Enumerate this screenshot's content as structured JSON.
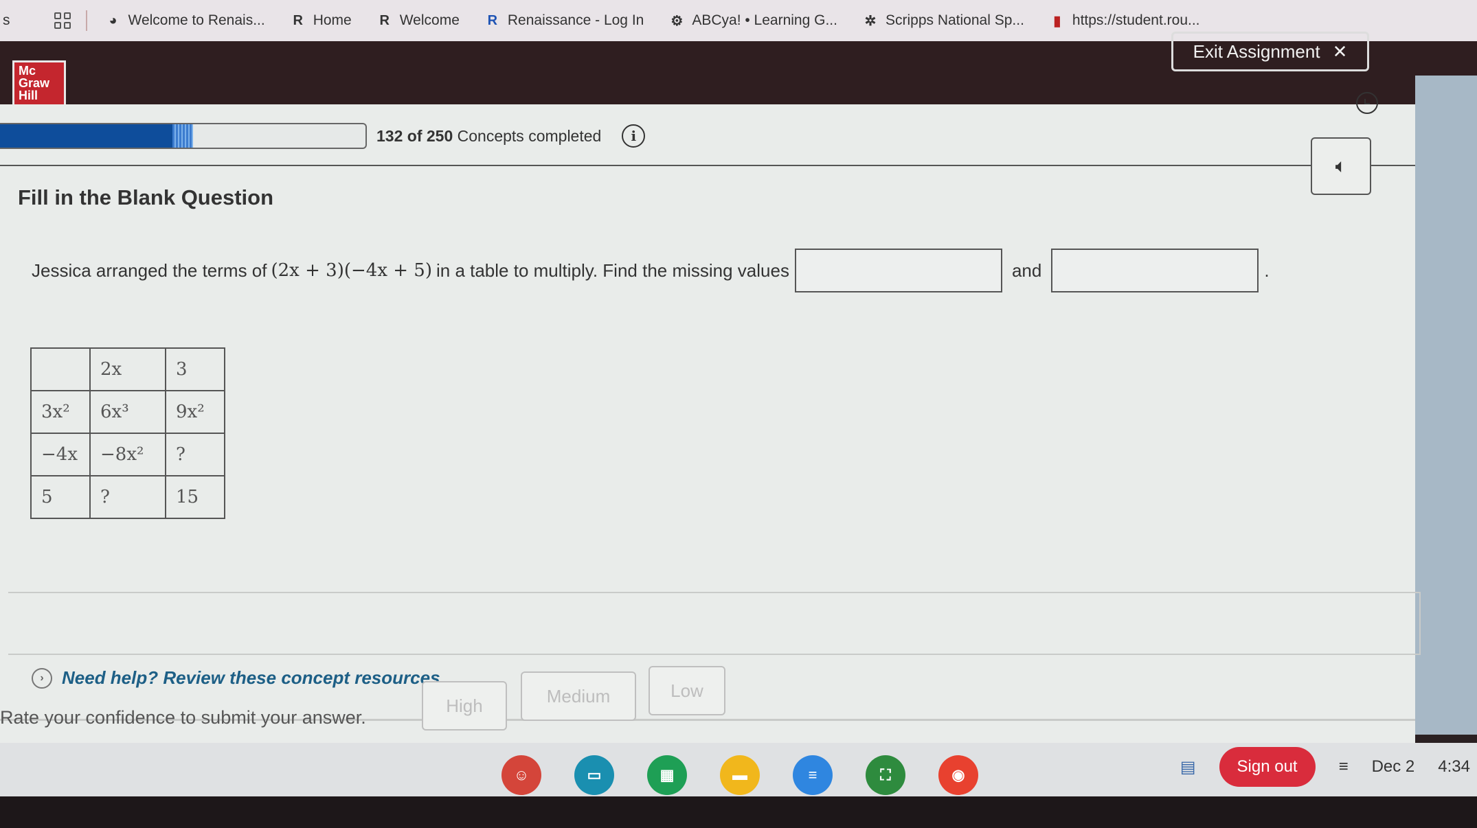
{
  "bookmarks": [
    {
      "icon": "partial-bookmark",
      "label": "s"
    },
    {
      "icon": "globe-icon",
      "label": "Welcome to Renais..."
    },
    {
      "icon": "renaissance-icon",
      "label": "Home"
    },
    {
      "icon": "renaissance-icon",
      "label": "Welcome"
    },
    {
      "icon": "renaissance-r-icon",
      "label": "Renaissance - Log In"
    },
    {
      "icon": "abcya-icon",
      "label": "ABCya! • Learning G..."
    },
    {
      "icon": "scripps-icon",
      "label": "Scripps National Sp..."
    },
    {
      "icon": "student-icon",
      "label": "https://student.rou..."
    }
  ],
  "header": {
    "logo_lines": [
      "Mc",
      "Graw",
      "Hill"
    ],
    "exit_label": "Exit Assignment",
    "exit_icon": "✕"
  },
  "progress": {
    "completed": 132,
    "total": 250,
    "fraction": 0.528,
    "count_text": "132 of 250",
    "suffix": "Concepts completed",
    "info_icon": "i"
  },
  "question": {
    "type_title": "Fill in the Blank Question",
    "prefix": "Jessica arranged the terms of",
    "expression": "(2x + 3)(−4x + 5)",
    "middle": "in a table to multiply. Find the missing values",
    "blank1_value": "",
    "and": "and",
    "blank2_value": "",
    "end": "."
  },
  "table": {
    "rows": [
      [
        "",
        "2x",
        "3"
      ],
      [
        "3x²",
        "6x³",
        "9x²"
      ],
      [
        "−4x",
        "−8x²",
        "?"
      ],
      [
        "5",
        "?",
        "15"
      ]
    ]
  },
  "help": {
    "icon": "›",
    "label": "Need help? Review these concept resources."
  },
  "confidence": {
    "label": "Rate your confidence to submit your answer.",
    "options": [
      "High",
      "Medium",
      "Low"
    ]
  },
  "shelf": {
    "apps": [
      {
        "name": "app-red",
        "color": "#d4453a",
        "glyph": "☺"
      },
      {
        "name": "app-classroom-teal",
        "color": "#1a8fb0",
        "glyph": "▭"
      },
      {
        "name": "app-sheets",
        "color": "#1e9f55",
        "glyph": "▦"
      },
      {
        "name": "app-slides",
        "color": "#f1b71c",
        "glyph": "▬"
      },
      {
        "name": "app-docs",
        "color": "#2f86e0",
        "glyph": "≡"
      },
      {
        "name": "app-classroom",
        "color": "#2e8b3e",
        "glyph": "⛶"
      },
      {
        "name": "app-chrome",
        "color": "#e8412f",
        "glyph": "◉"
      }
    ],
    "signout_label": "Sign out",
    "date": "Dec 2",
    "time": "4:34"
  }
}
